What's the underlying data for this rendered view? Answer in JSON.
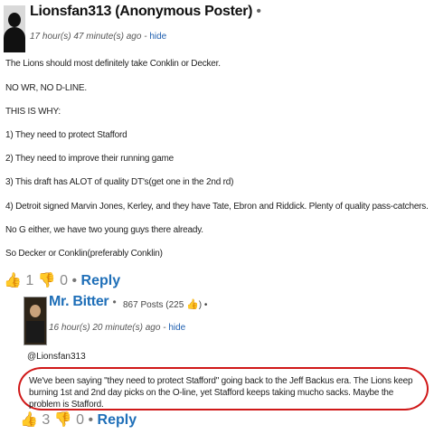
{
  "comment": {
    "author": "Lionsfan313 (Anonymous Poster)",
    "author_dot": "•",
    "time": "17 hour(s) 47 minute(s) ago",
    "sep": "-",
    "hide_label": "hide",
    "lines": [
      "The Lions should most definitely take Conklin or Decker.",
      "NO WR, NO D-LINE.",
      "THIS IS WHY:",
      "1) They need to protect Stafford",
      "2) They need to improve their running game",
      "3) This draft has ALOT of quality DT's(get one in the 2nd rd)",
      "4) Detroit signed Marvin Jones, Kerley, and they have Tate, Ebron and Riddick. Plenty of quality pass-catchers.",
      "No G either, we have two young guys there already.",
      "So Decker or Conklin(preferably Conklin)"
    ],
    "upvotes": "1",
    "downvotes": "0",
    "reply_dot": "•",
    "reply_label": "Reply"
  },
  "reply": {
    "author": "Mr. Bitter",
    "author_dot": "•",
    "posts": "867 Posts (225",
    "posts_close": ")",
    "posts_dot": "•",
    "time": "16 hour(s) 20 minute(s) ago",
    "sep": "-",
    "hide_label": "hide",
    "mention": "@Lionsfan313",
    "text": "We've been saying \"they need to protect Stafford\" going back to the Jeff Backus era. The Lions keep burning 1st and 2nd day picks on the O-line, yet Stafford keeps taking mucho sacks. Maybe the problem is Stafford.",
    "upvotes": "3",
    "downvotes": "0",
    "reply_dot": "•",
    "reply_label": "Reply"
  },
  "icons": {
    "up": "thumbs-up-icon",
    "down": "thumbs-down-icon"
  },
  "colors": {
    "link_blue": "#1f6fb8",
    "upvote_green": "#7cc06a",
    "downvote_red": "#e56e6e",
    "highlight_red": "#d01818"
  }
}
